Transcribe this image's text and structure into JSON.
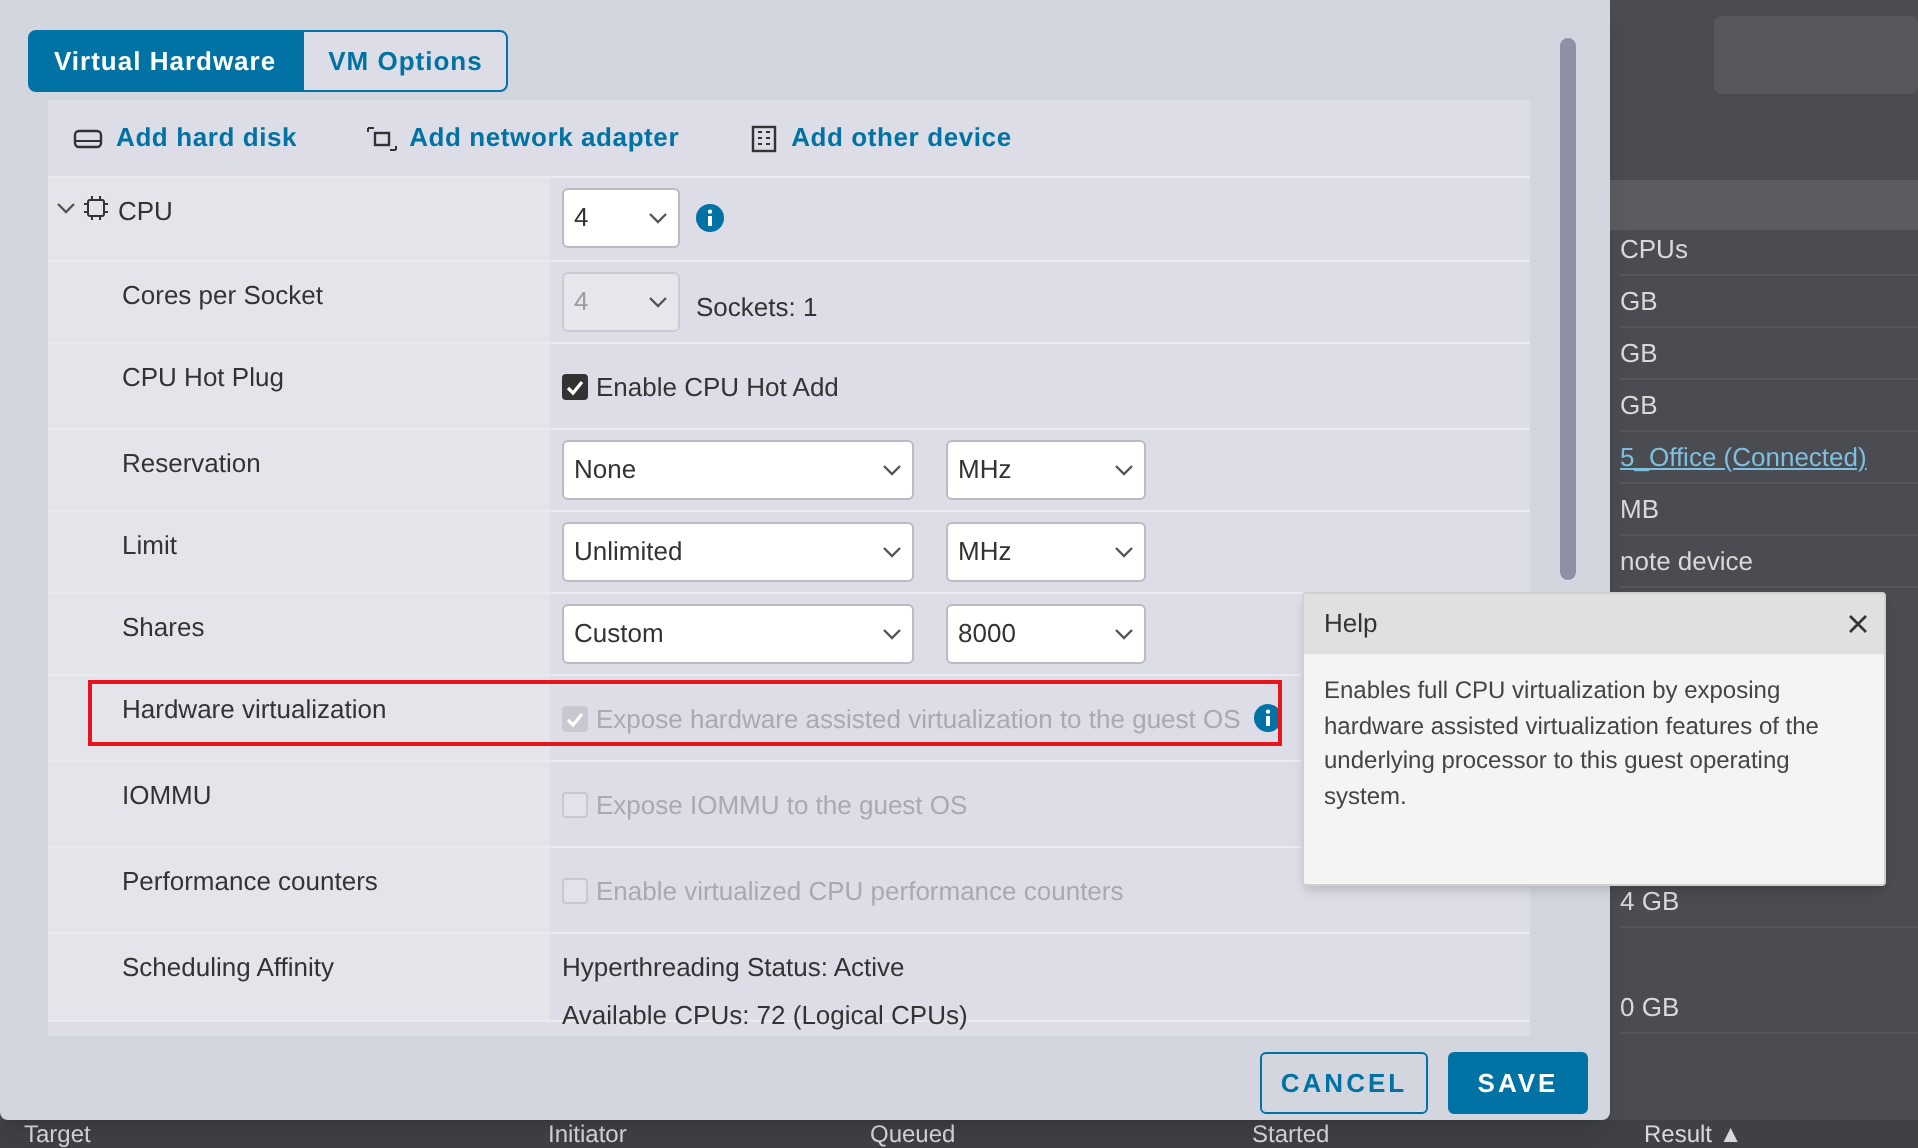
{
  "tabs": [
    {
      "label": "Virtual Hardware",
      "selected": true
    },
    {
      "label": "VM Options",
      "selected": false
    }
  ],
  "toolbar": [
    {
      "label": "Add hard disk"
    },
    {
      "label": "Add network adapter"
    },
    {
      "label": "Add other device"
    }
  ],
  "rows": [
    {
      "kind": "cpu",
      "label": "CPU",
      "expanded": true,
      "value": "4"
    },
    {
      "kind": "select_note",
      "label": "Cores per Socket",
      "value": "4",
      "disabled": true,
      "note": "Sockets: 1"
    },
    {
      "kind": "checkbox",
      "label": "CPU Hot Plug",
      "text": "Enable CPU Hot Add",
      "checked": true,
      "disabled": false
    },
    {
      "kind": "two_selects",
      "label": "Reservation",
      "value": "None",
      "unit": "MHz"
    },
    {
      "kind": "two_selects",
      "label": "Limit",
      "value": "Unlimited",
      "unit": "MHz"
    },
    {
      "kind": "two_selects",
      "label": "Shares",
      "value": "Custom",
      "unit": "8000"
    },
    {
      "kind": "checkbox",
      "label": "Hardware virtualization",
      "text": "Expose hardware assisted virtualization to the guest OS",
      "checked": true,
      "disabled": true,
      "info": true,
      "highlighted": true
    },
    {
      "kind": "checkbox",
      "label": "IOMMU",
      "text": "Expose IOMMU to the guest OS",
      "checked": false,
      "disabled": true
    },
    {
      "kind": "checkbox",
      "label": "Performance counters",
      "text": "Enable virtualized CPU performance counters",
      "checked": false,
      "disabled": true
    },
    {
      "kind": "lines",
      "label": "Scheduling Affinity",
      "lines": [
        "Hyperthreading Status: Active",
        "Available CPUs: 72 (Logical CPUs)"
      ]
    }
  ],
  "buttons": [
    {
      "label": "CANCEL",
      "kind": "secondary"
    },
    {
      "label": "SAVE",
      "kind": "primary"
    }
  ],
  "help": {
    "title": "Help",
    "body": "Enables full CPU virtualization by exposing hardware assisted virtualization features of the underlying processor to this guest operating system."
  },
  "background_page": {
    "upper_rows": [
      {
        "text": "CPUs",
        "link": false
      },
      {
        "text": "GB",
        "link": false
      },
      {
        "text": "GB",
        "link": false
      },
      {
        "text": "GB",
        "link": false
      },
      {
        "text": "5_Office (Connected)",
        "link": true
      },
      {
        "text": "MB",
        "link": false
      },
      {
        "text": "note device",
        "link": false
      }
    ],
    "lower_rows": [
      {
        "text": "4 GB",
        "link": false
      },
      {
        "text": "0 GB",
        "link": false
      }
    ],
    "table_headers": [
      "Target",
      "Initiator",
      "Queued",
      "Started",
      "Result ▲"
    ]
  }
}
